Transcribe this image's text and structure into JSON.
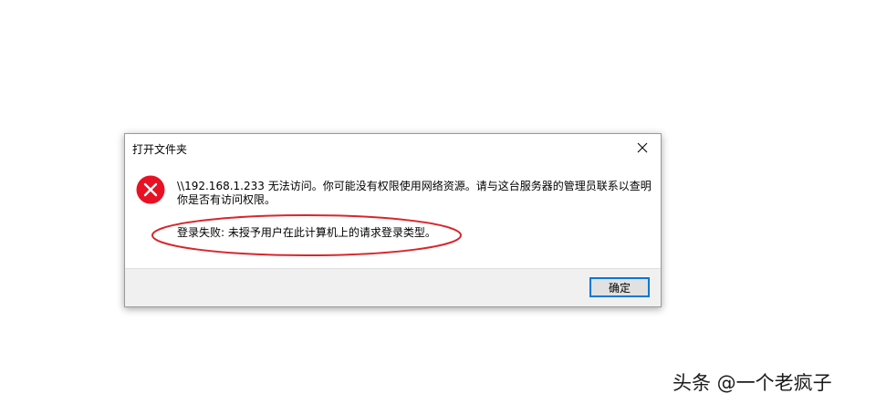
{
  "dialog": {
    "title": "打开文件夹",
    "message": "\\\\192.168.1.233 无法访问。你可能没有权限使用网络资源。请与这台服务器的管理员联系以查明你是否有访问权限。",
    "detail": "登录失败: 未授予用户在此计算机上的请求登录类型。",
    "ok_label": "确定",
    "icon": "error-icon",
    "close_icon": "close-icon"
  },
  "annotation": {
    "shape": "red-ellipse",
    "color": "#d9262b"
  },
  "watermark": {
    "text": "头条 @一个老疯子"
  }
}
